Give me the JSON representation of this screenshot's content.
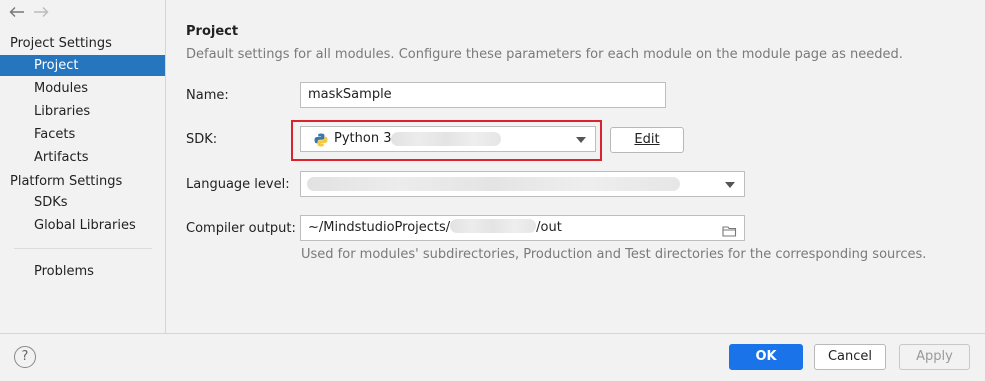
{
  "nav": {
    "back_icon": "arrow-left-icon",
    "forward_icon": "arrow-right-icon"
  },
  "sidebar": {
    "project_settings_label": "Project Settings",
    "project_items": [
      {
        "label": "Project",
        "selected": true
      },
      {
        "label": "Modules"
      },
      {
        "label": "Libraries"
      },
      {
        "label": "Facets"
      },
      {
        "label": "Artifacts"
      }
    ],
    "platform_settings_label": "Platform Settings",
    "platform_items": [
      {
        "label": "SDKs"
      },
      {
        "label": "Global Libraries"
      }
    ],
    "problems_label": "Problems"
  },
  "main": {
    "title": "Project",
    "description": "Default settings for all modules. Configure these parameters for each module on the module page as needed.",
    "name_label": "Name:",
    "name_value": "maskSample",
    "sdk_label": "SDK:",
    "sdk_value": "Python 3",
    "sdk_icon": "python-icon",
    "edit_button": "Edit",
    "language_level_label": "Language level:",
    "compiler_output_label": "Compiler output:",
    "compiler_output_prefix": "~/MindstudioProjects/",
    "compiler_output_suffix": "/out",
    "folder_icon": "folder-icon",
    "compiler_output_hint": "Used for modules' subdirectories, Production and Test directories for the corresponding sources."
  },
  "footer": {
    "help_icon": "help-icon",
    "help_glyph": "?",
    "ok_label": "OK",
    "cancel_label": "Cancel",
    "apply_label": "Apply"
  },
  "colors": {
    "accent": "#2675bf",
    "ok_button": "#1a73e8",
    "highlight": "#d9232d"
  }
}
